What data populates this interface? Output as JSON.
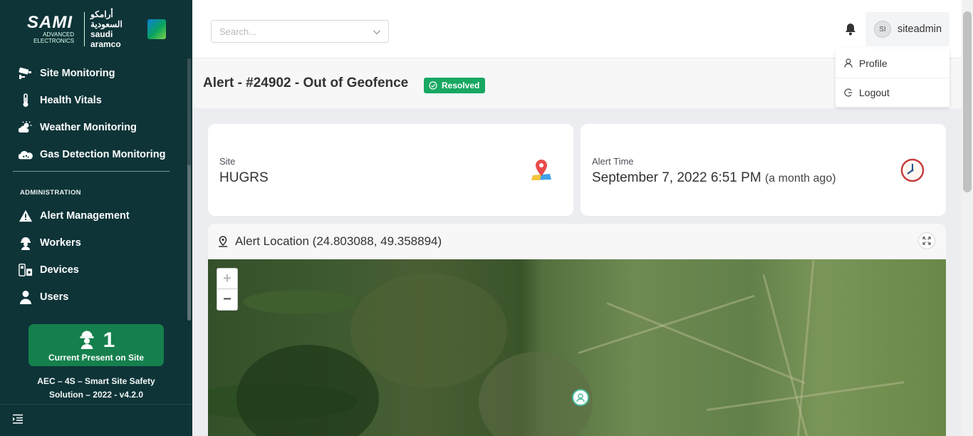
{
  "brand": {
    "sami": "SAMI",
    "sami_sub1": "ADVANCED",
    "sami_sub2": "ELECTRONICS",
    "aramco_ar": "أرامكو السعودية",
    "aramco_en": "saudi aramco"
  },
  "sidebar": {
    "items": [
      {
        "label": "Site Monitoring",
        "icon": "cctv-camera-icon"
      },
      {
        "label": "Health Vitals",
        "icon": "thermometer-icon"
      },
      {
        "label": "Weather Monitoring",
        "icon": "sun-cloud-icon"
      },
      {
        "label": "Gas Detection Monitoring",
        "icon": "gas-cloud-icon"
      }
    ],
    "section_title": "ADMINISTRATION",
    "admin_items": [
      {
        "label": "Alert Management",
        "icon": "warning-icon"
      },
      {
        "label": "Workers",
        "icon": "worker-helmet-icon"
      },
      {
        "label": "Devices",
        "icon": "devices-icon"
      },
      {
        "label": "Users",
        "icon": "user-icon"
      }
    ],
    "present_count": "1",
    "present_label": "Current Present on Site",
    "version_line1": "AEC – 4S – Smart Site Safety",
    "version_line2": "Solution – 2022 - v4.2.0"
  },
  "header": {
    "search_placeholder": "Search...",
    "avatar_initials": "SI",
    "username": "siteadmin",
    "menu": [
      {
        "label": "Profile",
        "icon": "user-outline-icon"
      },
      {
        "label": "Logout",
        "icon": "logout-icon"
      }
    ]
  },
  "page": {
    "title": "Alert - #24902 - Out of Geofence",
    "status": "Resolved",
    "status_color": "#17a862"
  },
  "cards": {
    "site_label": "Site",
    "site_value": "HUGRS",
    "time_label": "Alert Time",
    "time_value": "September 7, 2022 6:51 PM",
    "time_relative": "(a month ago)"
  },
  "map": {
    "title": "Alert Location (24.803088, 49.358894)",
    "zoom_in": "+",
    "zoom_out": "−"
  },
  "colors": {
    "sidebar_bg": "#0e3438",
    "present_card": "#15804d"
  }
}
